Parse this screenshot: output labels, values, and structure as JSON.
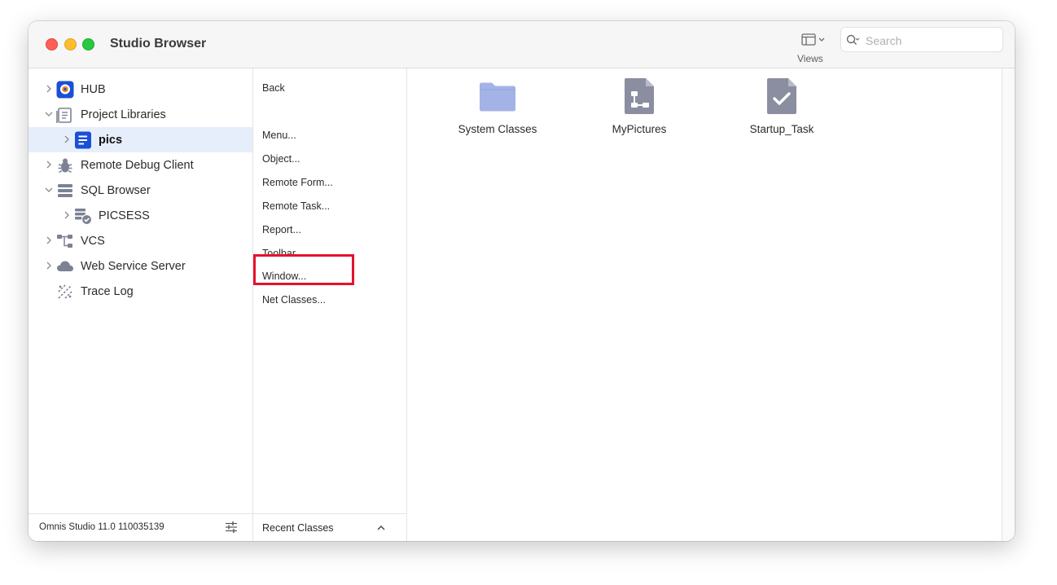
{
  "window": {
    "title": "Studio Browser"
  },
  "toolbar": {
    "views_label": "Views",
    "search_placeholder": "Search"
  },
  "sidebar": {
    "items": [
      {
        "label": "HUB",
        "icon": "hub-icon"
      },
      {
        "label": "Project Libraries",
        "icon": "library-icon"
      },
      {
        "label": "pics",
        "icon": "library-document-icon"
      },
      {
        "label": "Remote Debug Client",
        "icon": "bug-icon"
      },
      {
        "label": "SQL Browser",
        "icon": "database-icon"
      },
      {
        "label": "PICSESS",
        "icon": "session-icon"
      },
      {
        "label": "VCS",
        "icon": "branch-icon"
      },
      {
        "label": "Web Service Server",
        "icon": "cloud-icon"
      },
      {
        "label": "Trace Log",
        "icon": "trace-icon"
      }
    ],
    "footer": {
      "version": "Omnis Studio 11.0 110035139"
    }
  },
  "menu": {
    "back": "Back",
    "items": [
      "Menu...",
      "Object...",
      "Remote Form...",
      "Remote Task...",
      "Report...",
      "Toolbar...",
      "Window...",
      "Net Classes..."
    ],
    "highlighted": "Window...",
    "footer_label": "Recent Classes"
  },
  "content": {
    "items": [
      {
        "label": "System Classes",
        "icon": "folder-icon"
      },
      {
        "label": "MyPictures",
        "icon": "file-diagram-icon"
      },
      {
        "label": "Startup_Task",
        "icon": "file-check-icon"
      }
    ]
  },
  "colors": {
    "accent": "#1a4fd6",
    "selection": "#e7eefb",
    "icon_gray": "#8a8ea0",
    "folder": "#a4b3e6",
    "highlight": "#e8112d"
  }
}
